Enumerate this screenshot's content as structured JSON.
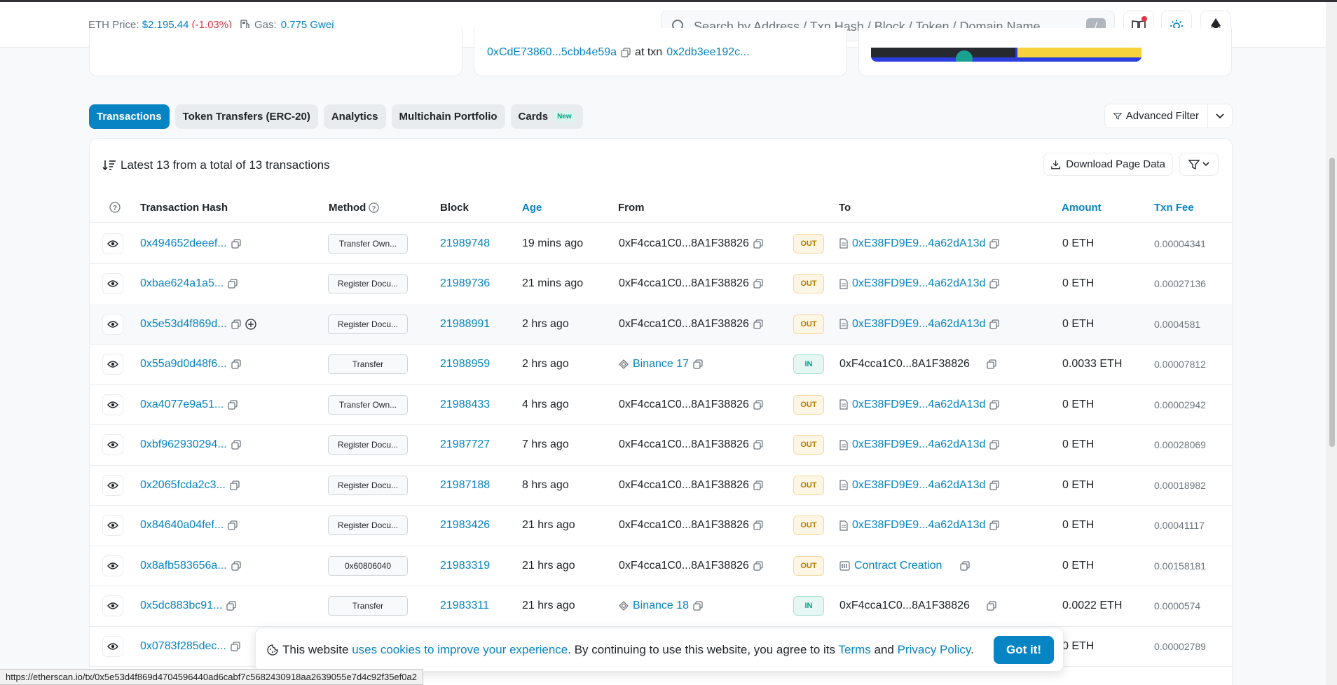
{
  "header": {
    "eth_label": "ETH Price:",
    "eth_price": "$2,195.44",
    "eth_change": "(-1.03%)",
    "gas_label": "Gas:",
    "gas_value": "0.775 Gwei",
    "search_placeholder": "Search by Address / Txn Hash / Block / Token / Domain Name",
    "search_shortcut": "/"
  },
  "top_cards": {
    "address": "0xCdE73860...5cbb4e59a",
    "at_txn_label": "at txn",
    "txn": "0x2db3ee192c..."
  },
  "tabs": [
    {
      "label": "Transactions",
      "active": true
    },
    {
      "label": "Token Transfers (ERC-20)"
    },
    {
      "label": "Analytics"
    },
    {
      "label": "Multichain Portfolio"
    },
    {
      "label": "Cards",
      "badge": "New"
    }
  ],
  "advanced_filter_label": "Advanced Filter",
  "summary": "Latest 13 from a total of 13 transactions",
  "download_label": "Download Page Data",
  "columns": {
    "hash": "Transaction Hash",
    "method": "Method",
    "block": "Block",
    "age": "Age",
    "from": "From",
    "to": "To",
    "amount": "Amount",
    "fee": "Txn Fee"
  },
  "rows": [
    {
      "hash": "0x494652deeef...",
      "method": "Transfer Own...",
      "block": "21989748",
      "age": "19 mins ago",
      "from": "0xF4cca1C0...8A1F38826",
      "dir": "OUT",
      "to": "0xE38FD9E9...4a62dA13d",
      "amount": "0 ETH",
      "fee": "0.00004341"
    },
    {
      "hash": "0xbae624a1a5...",
      "method": "Register Docu...",
      "block": "21989736",
      "age": "21 mins ago",
      "from": "0xF4cca1C0...8A1F38826",
      "dir": "OUT",
      "to": "0xE38FD9E9...4a62dA13d",
      "amount": "0 ETH",
      "fee": "0.00027136"
    },
    {
      "hash": "0x5e53d4f869d...",
      "method": "Register Docu...",
      "block": "21988991",
      "age": "2 hrs ago",
      "from": "0xF4cca1C0...8A1F38826",
      "dir": "OUT",
      "to": "0xE38FD9E9...4a62dA13d",
      "amount": "0 ETH",
      "fee": "0.0004581"
    },
    {
      "hash": "0x55a9d0d48f6...",
      "method": "Transfer",
      "block": "21988959",
      "age": "2 hrs ago",
      "from": "Binance 17",
      "dir": "IN",
      "to": "0xF4cca1C0...8A1F38826",
      "amount": "0.0033 ETH",
      "fee": "0.00007812"
    },
    {
      "hash": "0xa4077e9a51...",
      "method": "Transfer Own...",
      "block": "21988433",
      "age": "4 hrs ago",
      "from": "0xF4cca1C0...8A1F38826",
      "dir": "OUT",
      "to": "0xE38FD9E9...4a62dA13d",
      "amount": "0 ETH",
      "fee": "0.00002942"
    },
    {
      "hash": "0xbf962930294...",
      "method": "Register Docu...",
      "block": "21987727",
      "age": "7 hrs ago",
      "from": "0xF4cca1C0...8A1F38826",
      "dir": "OUT",
      "to": "0xE38FD9E9...4a62dA13d",
      "amount": "0 ETH",
      "fee": "0.00028069"
    },
    {
      "hash": "0x2065fcda2c3...",
      "method": "Register Docu...",
      "block": "21987188",
      "age": "8 hrs ago",
      "from": "0xF4cca1C0...8A1F38826",
      "dir": "OUT",
      "to": "0xE38FD9E9...4a62dA13d",
      "amount": "0 ETH",
      "fee": "0.00018982"
    },
    {
      "hash": "0x84640a04fef...",
      "method": "Register Docu...",
      "block": "21983426",
      "age": "21 hrs ago",
      "from": "0xF4cca1C0...8A1F38826",
      "dir": "OUT",
      "to": "0xE38FD9E9...4a62dA13d",
      "amount": "0 ETH",
      "fee": "0.00041117"
    },
    {
      "hash": "0x8afb583656a...",
      "method": "0x60806040",
      "block": "21983319",
      "age": "21 hrs ago",
      "from": "0xF4cca1C0...8A1F38826",
      "dir": "OUT",
      "to": "Contract Creation",
      "amount": "0 ETH",
      "fee": "0.00158181"
    },
    {
      "hash": "0x5dc883bc91...",
      "method": "Transfer",
      "block": "21983311",
      "age": "21 hrs ago",
      "from": "Binance 18",
      "dir": "IN",
      "to": "0xF4cca1C0...8A1F38826",
      "amount": "0.0022 ETH",
      "fee": "0.0000574"
    },
    {
      "hash": "0x0783f285dec...",
      "method": "",
      "block": "",
      "age": "",
      "from": "",
      "dir": "",
      "to": "",
      "amount": "0 ETH",
      "fee": "0.00002789"
    }
  ],
  "cookie": {
    "text1": "This website",
    "link1": "uses cookies to improve your experience",
    "text2": ". By continuing to use this website, you agree to its",
    "terms": "Terms",
    "and": "and",
    "privacy": "Privacy Policy",
    "dot": ".",
    "button": "Got it!"
  },
  "status_url": "https://etherscan.io/tx/0x5e53d4f869d4704596440ad6cabf7c5682430918aa2639055e7d4c92f35ef0a2",
  "colors": {
    "accent": "#0784c3",
    "out": "#b47d00",
    "in": "#00a186",
    "negative": "#dc3545"
  }
}
